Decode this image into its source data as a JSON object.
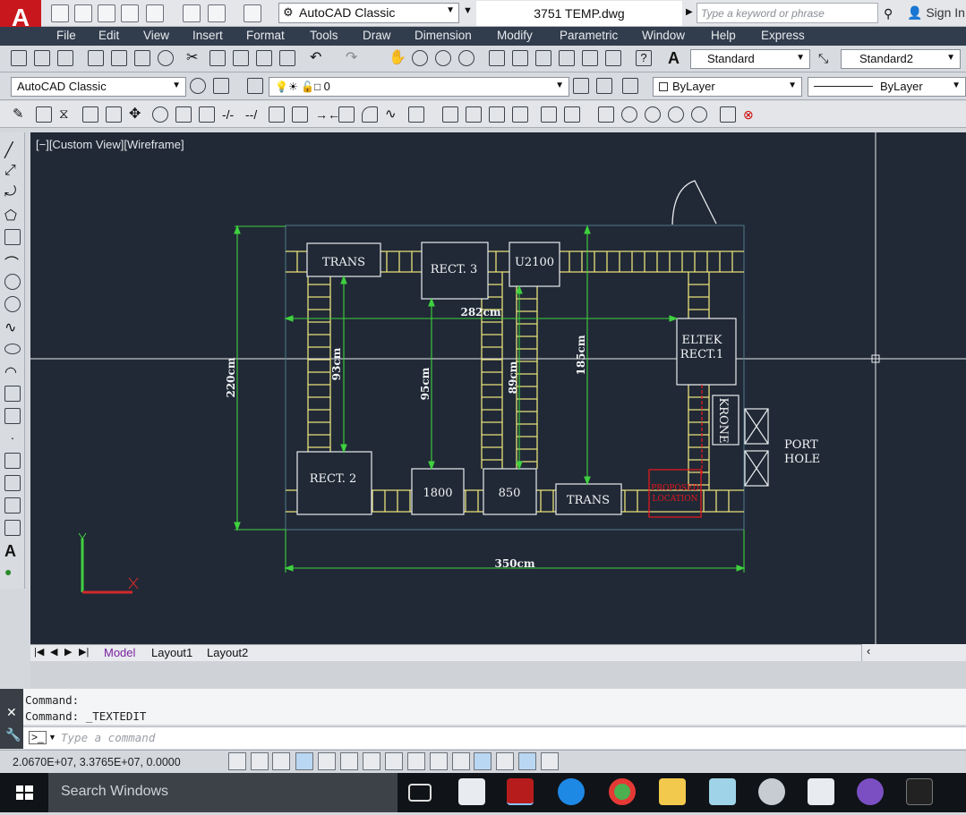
{
  "title_bar": {
    "app_letter": "A",
    "workspace": "AutoCAD Classic",
    "document_title": "3751 TEMP.dwg",
    "search_placeholder": "Type a keyword or phrase",
    "sign_in": "Sign In"
  },
  "menu": [
    "File",
    "Edit",
    "View",
    "Insert",
    "Format",
    "Tools",
    "Draw",
    "Dimension",
    "Modify",
    "Parametric",
    "Window",
    "Help",
    "Express"
  ],
  "toolbar2": {
    "text_style": "Standard",
    "dim_style": "Standard2"
  },
  "toolbar3": {
    "workspace": "AutoCAD Classic",
    "layer": "0",
    "color": "ByLayer",
    "linetype": "ByLayer"
  },
  "viewport_label": "[−][Custom View][Wireframe]",
  "drawing": {
    "labels": {
      "trans_top": "TRANS",
      "rect3": "RECT. 3",
      "u2100": "U2100",
      "eltek": "ELTEK",
      "rect1": "RECT.1",
      "krone": "KRONE",
      "port": "PORT",
      "hole": "HOLE",
      "rect2": "RECT. 2",
      "n1800": "1800",
      "n850": "850",
      "trans_bottom": "TRANS",
      "proposed": "PROPOSED",
      "location": "LOCATION"
    },
    "dimensions": {
      "d282": "282cm",
      "d93": "93cm",
      "d95": "95cm",
      "d89": "89cm",
      "d185": "185cm",
      "d220": "220cm",
      "d350": "350cm"
    }
  },
  "tabs": {
    "model": "Model",
    "layout1": "Layout1",
    "layout2": "Layout2"
  },
  "command": {
    "line1": "Command:",
    "line2": "Command: _TEXTEDIT",
    "input_placeholder": "Type a command"
  },
  "status": {
    "coordinates": "2.0670E+07, 3.3765E+07, 0.0000"
  },
  "taskbar": {
    "search_placeholder": "Search Windows"
  },
  "colors": {
    "canvas": "#212936",
    "tray_yellow": "#e8e27a",
    "dimension_green": "#3fd13f",
    "proposed_red": "#e0181e",
    "menu_bar": "#313c4c"
  }
}
